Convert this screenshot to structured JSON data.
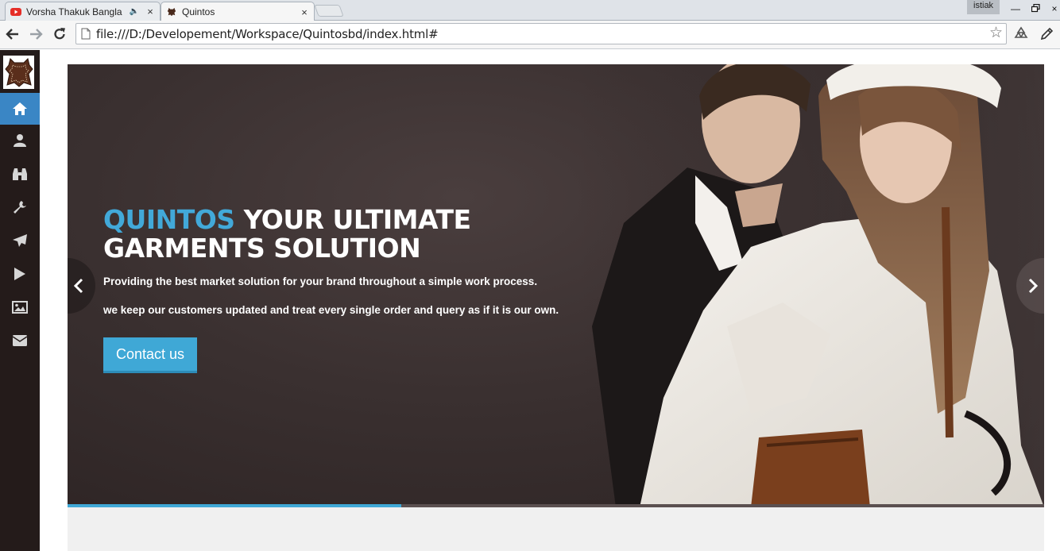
{
  "browser": {
    "tabs": [
      {
        "title": "Vorsha Thakuk Bangla",
        "favicon": "youtube-icon",
        "playing_audio": true
      },
      {
        "title": "Quintos",
        "favicon": "leather-hide-icon",
        "active": true
      }
    ],
    "user_name": "istiak",
    "url": "file:///D:/Developement/Workspace/Quintosbd/index.html#"
  },
  "sidebar": {
    "items": [
      {
        "icon": "home-icon",
        "active": true
      },
      {
        "icon": "user-icon"
      },
      {
        "icon": "binoculars-icon"
      },
      {
        "icon": "wrench-icon"
      },
      {
        "icon": "paper-plane-icon"
      },
      {
        "icon": "play-icon"
      },
      {
        "icon": "image-icon"
      },
      {
        "icon": "envelope-icon"
      }
    ],
    "active_color": "#3a86c5",
    "background": "#241b1a"
  },
  "hero": {
    "headline_brand": "QUINTOS",
    "headline_rest": " YOUR ULTIMATE GARMENTS SOLUTION",
    "subline_1": "Providing the best market solution for your brand throughout a simple work process.",
    "subline_2": "we keep our customers updated and treat every single order and query as if it is our own.",
    "cta_label": "Contact us",
    "accent_color": "#3fa8d6",
    "slide_progress": 0.342
  }
}
